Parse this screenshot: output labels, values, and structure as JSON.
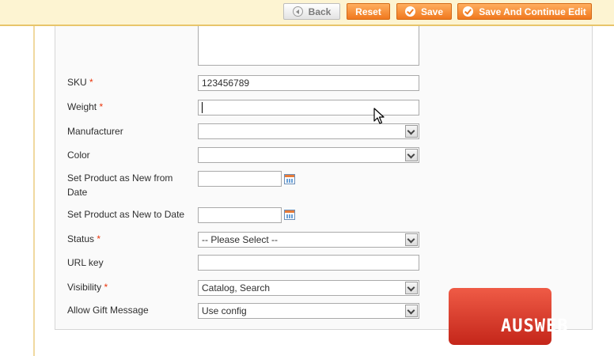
{
  "toolbar": {
    "back_label": "Back",
    "reset_label": "Reset",
    "save_label": "Save",
    "save_continue_label": "Save And Continue Edit",
    "back_icon": "back-arrow-icon",
    "check_icon": "check-icon"
  },
  "form": {
    "required_mark": "*",
    "sku": {
      "label": "SKU",
      "value": "123456789"
    },
    "weight": {
      "label": "Weight",
      "value": ""
    },
    "manufacturer": {
      "label": "Manufacturer",
      "value": ""
    },
    "color": {
      "label": "Color",
      "value": ""
    },
    "news_from": {
      "label_line1": "Set Product as New from",
      "label_line2": "Date",
      "value": ""
    },
    "news_to": {
      "label": "Set Product as New to Date",
      "value": ""
    },
    "status": {
      "label": "Status",
      "value": "-- Please Select --"
    },
    "url_key": {
      "label": "URL key",
      "value": ""
    },
    "visibility": {
      "label": "Visibility",
      "value": "Catalog, Search"
    },
    "gift_message": {
      "label": "Allow Gift Message",
      "value": "Use config"
    }
  },
  "watermark": {
    "text": "AUSWEB"
  },
  "colors": {
    "accent_orange": "#f0781e",
    "header_bg": "#fdf4d2",
    "required_red": "#eb340a",
    "logo_red": "#d93a2b"
  }
}
